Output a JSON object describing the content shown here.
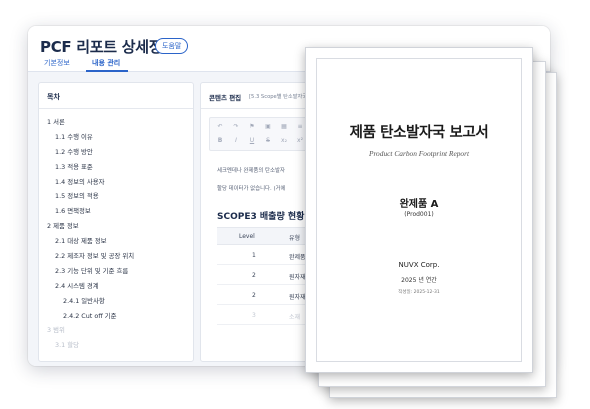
{
  "header": {
    "title": "PCF 리포트 상세정보",
    "help_label": "도움말"
  },
  "tabs": [
    {
      "label": "기본정보"
    },
    {
      "label": "내용 관리"
    }
  ],
  "toc": {
    "title": "목차",
    "items": [
      {
        "label": "1 서론"
      },
      {
        "label": "1.1 수행 이유"
      },
      {
        "label": "1.2 수행 방안"
      },
      {
        "label": "1.3 적용 표준"
      },
      {
        "label": "1.4 정보의 사용자"
      },
      {
        "label": "1.5 정보의 적용"
      },
      {
        "label": "1.6 면책정보"
      },
      {
        "label": "2 제품 정보"
      },
      {
        "label": "2.1 대상 제품 정보"
      },
      {
        "label": "2.2 제조자 정보 및 공장 위치"
      },
      {
        "label": "2.3 기능 단위 및 기준 흐름"
      },
      {
        "label": "2.4 시스템 경계"
      },
      {
        "label": "2.4.1 일반사항"
      },
      {
        "label": "2.4.2 Cut off 기준"
      },
      {
        "label": "3 범위"
      },
      {
        "label": "3.1 할당"
      }
    ]
  },
  "content": {
    "title": "콘텐츠 편집",
    "subtitle": "[5.3 Scope별 탄소발자국",
    "body_line1": "세크멘데나 완제품의 탄소발자",
    "body_line2": "할당 데이터가 없습니다. (거에",
    "section_title": "SCOPE3 배출량 현황",
    "table": {
      "headers": [
        "Level",
        "유형"
      ],
      "rows": [
        [
          "1",
          "완제품"
        ],
        [
          "2",
          "원자재"
        ],
        [
          "2",
          "원자재"
        ],
        [
          "3",
          "소재"
        ]
      ]
    }
  },
  "report": {
    "title": "제품 탄소발자국 보고서",
    "subtitle": "Product Carbon Footprint Report",
    "product": "완제품 A",
    "product_code": "(Prod001)",
    "company": "NUVX Corp.",
    "year": "2025 년 연간",
    "created": "작성일: 2025-12-31"
  },
  "colors": {
    "accent": "#2b64c9",
    "title_text": "#1b2b4b",
    "workspace_bg": "#f3f5f9"
  }
}
